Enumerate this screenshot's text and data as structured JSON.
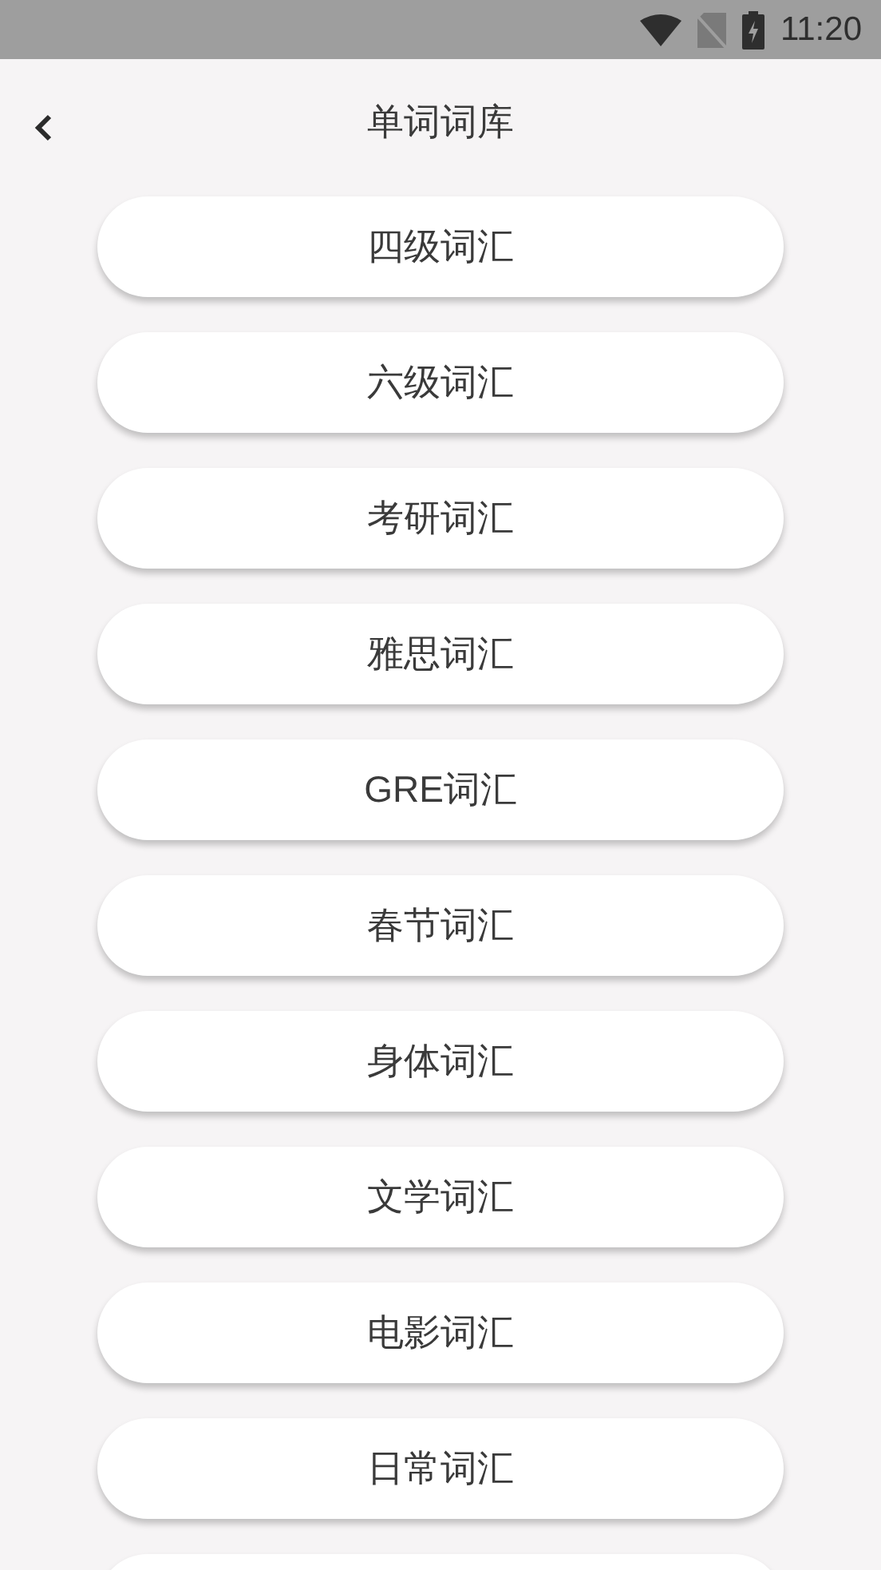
{
  "status_bar": {
    "time": "11:20"
  },
  "header": {
    "title": "单词词库"
  },
  "word_banks": [
    {
      "label": "四级词汇"
    },
    {
      "label": "六级词汇"
    },
    {
      "label": "考研词汇"
    },
    {
      "label": "雅思词汇"
    },
    {
      "label": "GRE词汇"
    },
    {
      "label": "春节词汇"
    },
    {
      "label": "身体词汇"
    },
    {
      "label": "文学词汇"
    },
    {
      "label": "电影词汇"
    },
    {
      "label": "日常词汇"
    }
  ]
}
